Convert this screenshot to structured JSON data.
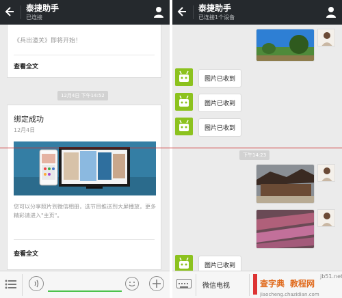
{
  "left": {
    "header": {
      "title": "泰捷助手",
      "subtitle": "已连接"
    },
    "card1": {
      "body": "《兵出潼关》即将开始！",
      "read_all": "查看全文"
    },
    "timestamp": "12月4日 下午14:52",
    "card2": {
      "title": "绑定成功",
      "date": "12月4日",
      "description": "您可以分享照片到微信相册，选节目推送到大屏播放，更多精彩请进入\"主页\"。",
      "read_all": "查看全文"
    }
  },
  "right": {
    "header": {
      "title": "泰捷助手",
      "subtitle": "已连接1个设备"
    },
    "replies": [
      "图片已收到",
      "图片已收到",
      "图片已收到",
      "图片已收到"
    ],
    "timestamp": "下午14:23",
    "bottom_menu": "微信电视",
    "watermark": [
      "查字典",
      "教程网",
      "jb51.net",
      "jiaocheng.chazidian.com"
    ]
  },
  "colors": {
    "titlebar": "#25292d",
    "chat_bg": "#ebebeb",
    "bot_green": "#8cc21e",
    "input_green": "#4cc24c"
  }
}
